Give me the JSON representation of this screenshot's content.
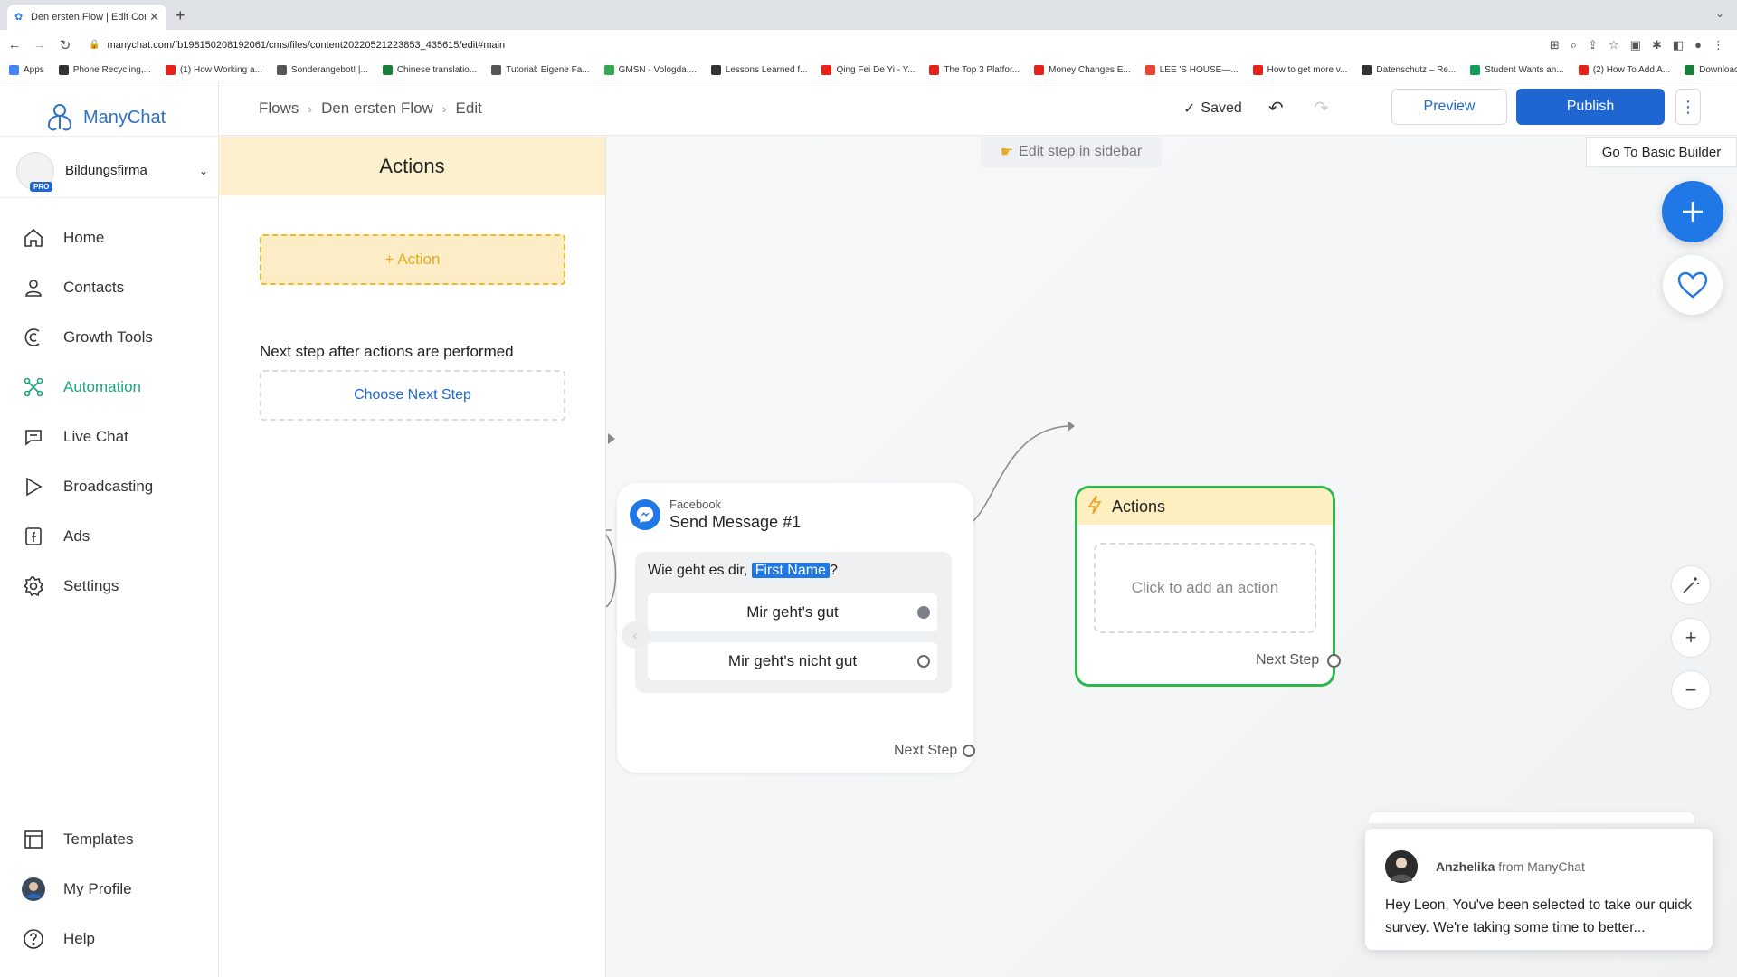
{
  "browser": {
    "tab_title": "Den ersten Flow | Edit Content",
    "url": "manychat.com/fb198150208192061/cms/files/content20220521223853_435615/edit#main",
    "bookmarks": [
      {
        "label": "Apps",
        "color": "#4285f4"
      },
      {
        "label": "Phone Recycling,...",
        "color": "#333333"
      },
      {
        "label": "(1) How Working a...",
        "color": "#e62117"
      },
      {
        "label": "Sonderangebot! |...",
        "color": "#555555"
      },
      {
        "label": "Chinese translatio...",
        "color": "#188038"
      },
      {
        "label": "Tutorial: Eigene Fa...",
        "color": "#555555"
      },
      {
        "label": "GMSN - Vologda,...",
        "color": "#34a853"
      },
      {
        "label": "Lessons Learned f...",
        "color": "#333333"
      },
      {
        "label": "Qing Fei De Yi - Y...",
        "color": "#e62117"
      },
      {
        "label": "The Top 3 Platfor...",
        "color": "#e62117"
      },
      {
        "label": "Money Changes E...",
        "color": "#e62117"
      },
      {
        "label": "LEE 'S HOUSE—...",
        "color": "#ea4335"
      },
      {
        "label": "How to get more v...",
        "color": "#e62117"
      },
      {
        "label": "Datenschutz – Re...",
        "color": "#333333"
      },
      {
        "label": "Student Wants an...",
        "color": "#0f9d58"
      },
      {
        "label": "(2) How To Add A...",
        "color": "#e62117"
      },
      {
        "label": "Download - Cooki...",
        "color": "#188038"
      }
    ]
  },
  "sidebar": {
    "brand": "ManyChat",
    "account": {
      "name": "Bildungsfirma",
      "badge": "PRO"
    },
    "items": [
      {
        "label": "Home",
        "icon": "home-icon"
      },
      {
        "label": "Contacts",
        "icon": "user-icon"
      },
      {
        "label": "Growth Tools",
        "icon": "growth-icon"
      },
      {
        "label": "Automation",
        "icon": "automation-icon",
        "active": true
      },
      {
        "label": "Live Chat",
        "icon": "chat-icon"
      },
      {
        "label": "Broadcasting",
        "icon": "send-icon"
      },
      {
        "label": "Ads",
        "icon": "ads-icon"
      },
      {
        "label": "Settings",
        "icon": "gear-icon"
      }
    ],
    "bottom": [
      {
        "label": "Templates",
        "icon": "templates-icon"
      },
      {
        "label": "My Profile",
        "icon": "avatar"
      },
      {
        "label": "Help",
        "icon": "help-icon"
      }
    ],
    "accent": "#1aa67e"
  },
  "header": {
    "breadcrumbs": [
      "Flows",
      "Den ersten Flow",
      "Edit"
    ],
    "saved": "Saved",
    "preview": "Preview",
    "publish": "Publish",
    "more": "⋮",
    "brand_color": "#1f66d1"
  },
  "panel": {
    "title": "Actions",
    "add_action": "+ Action",
    "next_step_label": "Next step after actions are performed",
    "choose_next": "Choose Next Step"
  },
  "canvas": {
    "edit_hint": "Edit step in sidebar",
    "basic_builder": "Go To Basic Builder",
    "message_node": {
      "source": "Facebook",
      "name": "Send Message #1",
      "text_before": "Wie geht es dir, ",
      "variable": "First Name",
      "text_after": "?",
      "replies": [
        "Mir geht's gut",
        "Mir geht's nicht gut"
      ],
      "next_step": "Next Step"
    },
    "actions_node": {
      "title": "Actions",
      "placeholder": "Click to add an action",
      "next_step": "Next Step"
    }
  },
  "chat": {
    "agent": "Anzhelika",
    "from": "from ManyChat",
    "message": "Hey Leon,  You've been selected to take our quick survey. We're taking some time to better..."
  }
}
